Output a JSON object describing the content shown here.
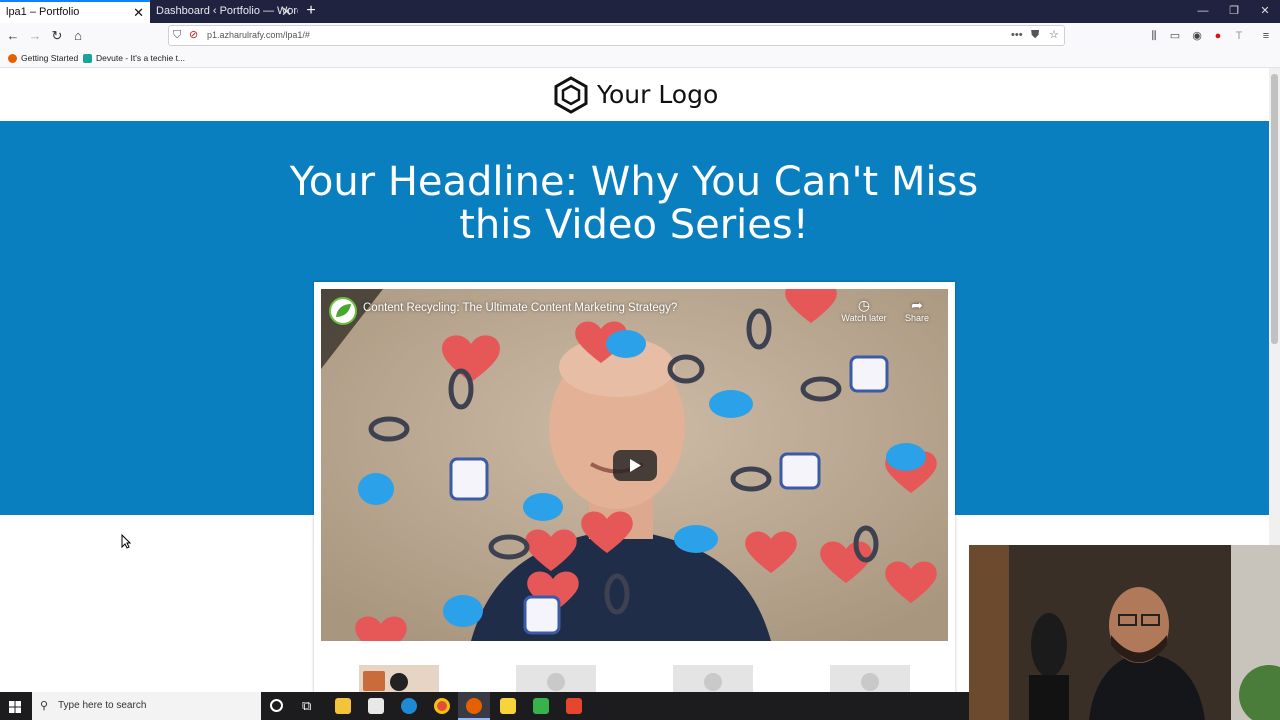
{
  "browser": {
    "tabs": [
      {
        "label": "lpa1 – Portfolio",
        "active": true
      },
      {
        "label": "Dashboard ‹ Portfolio — WordPress",
        "active": false
      }
    ],
    "url": "p1.azharulrafy.com/lpa1/#",
    "bookmarks": [
      {
        "label": "Getting Started"
      },
      {
        "label": "Devute - It's a techie t..."
      }
    ]
  },
  "page": {
    "logo_text": "Your Logo",
    "headline_line1": "Your Headline: Why You Can't Miss",
    "headline_line2": "this Video Series!",
    "hero_color": "#0a7fc0",
    "video": {
      "title": "Content Recycling: The Ultimate Content Marketing Strategy?",
      "watch_later_label": "Watch later",
      "share_label": "Share"
    }
  },
  "taskbar": {
    "search_placeholder": "Type here to search"
  }
}
